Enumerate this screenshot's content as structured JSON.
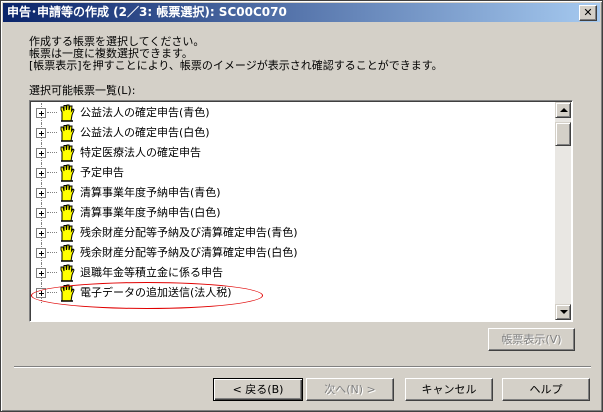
{
  "window": {
    "title": "申告･申請等の作成 (2／3: 帳票選択): SC00C070",
    "close_glyph": "✕"
  },
  "instructions": [
    "作成する帳票を選択してください。",
    "帳票は一度に複数選択できます。",
    "[帳票表示]を押すことにより、帳票のイメージが表示され確認することができます。"
  ],
  "list": {
    "label": "選択可能帳票一覧(L):",
    "items": [
      {
        "label": "公益法人の確定申告(青色)",
        "icon": "hand-document-icon"
      },
      {
        "label": "公益法人の確定申告(白色)",
        "icon": "hand-document-icon"
      },
      {
        "label": "特定医療法人の確定申告",
        "icon": "hand-document-icon"
      },
      {
        "label": "予定申告",
        "icon": "hand-document-icon"
      },
      {
        "label": "清算事業年度予納申告(青色)",
        "icon": "hand-document-icon"
      },
      {
        "label": "清算事業年度予納申告(白色)",
        "icon": "hand-document-icon"
      },
      {
        "label": "残余財産分配等予納及び清算確定申告(青色)",
        "icon": "hand-document-icon"
      },
      {
        "label": "残余財産分配等予納及び清算確定申告(白色)",
        "icon": "hand-document-icon"
      },
      {
        "label": "退職年金等積立金に係る申告",
        "icon": "hand-document-icon"
      },
      {
        "label": "電子データの追加送信(法人税)",
        "icon": "hand-document-icon"
      }
    ]
  },
  "buttons": {
    "view_form": "帳票表示(V)",
    "back": "< 戻る(B)",
    "next": "次へ(N) >",
    "cancel": "キャンセル",
    "help": "ヘルプ"
  },
  "colors": {
    "title_start": "#0a246a",
    "title_end": "#a6caf0",
    "face": "#d4d0c8",
    "hand_yellow": "#ffff00",
    "highlight_ellipse": "#e00000"
  }
}
